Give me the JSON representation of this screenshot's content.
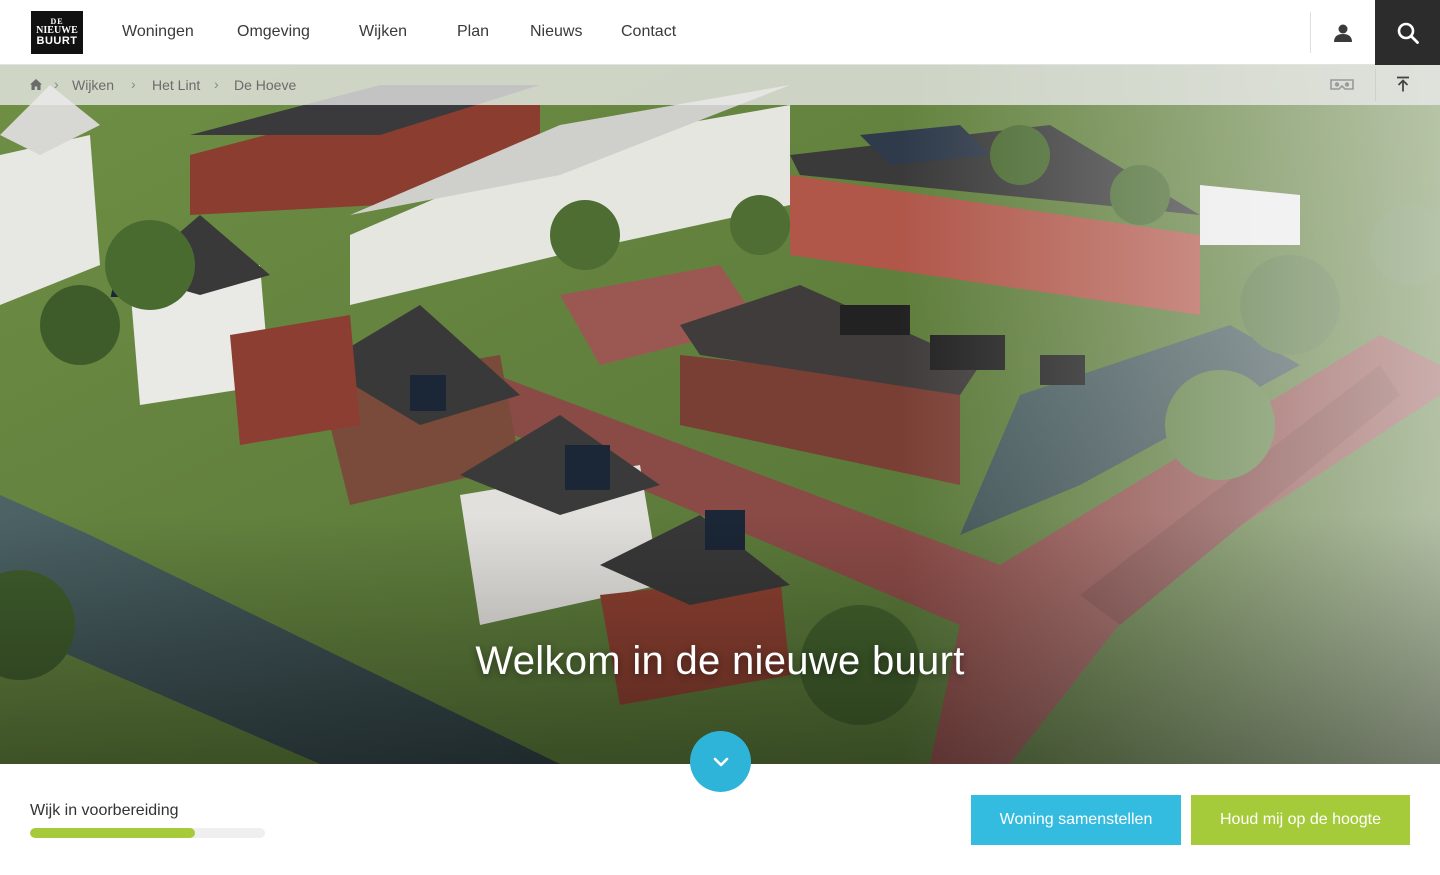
{
  "brand": {
    "logo_lines": [
      "DE",
      "NIEUWE",
      "BUURT"
    ]
  },
  "nav": {
    "items": [
      "Woningen",
      "Omgeving",
      "Wijken",
      "Plan",
      "Nieuws",
      "Contact"
    ]
  },
  "header": {
    "user_icon": "user-icon",
    "search_icon": "search-icon"
  },
  "breadcrumb": {
    "home_icon": "home-icon",
    "items": [
      "Wijken",
      "Het Lint",
      "De Hoeve"
    ],
    "separator": "›",
    "vr_icon": "vr-glasses-icon",
    "top_icon": "scroll-to-top-icon"
  },
  "hero": {
    "title": "Welkom in de nieuwe buurt",
    "scroll_icon": "chevron-down-icon"
  },
  "status": {
    "label": "Wijk in voorbereiding",
    "progress": 0.7
  },
  "actions": {
    "compose_label": "Woning samenstellen",
    "notify_label": "Houd mij op de hoogte"
  },
  "colors": {
    "accent_blue": "#34bbe0",
    "accent_green": "#a6cb3a",
    "dark": "#2c2c2c"
  }
}
